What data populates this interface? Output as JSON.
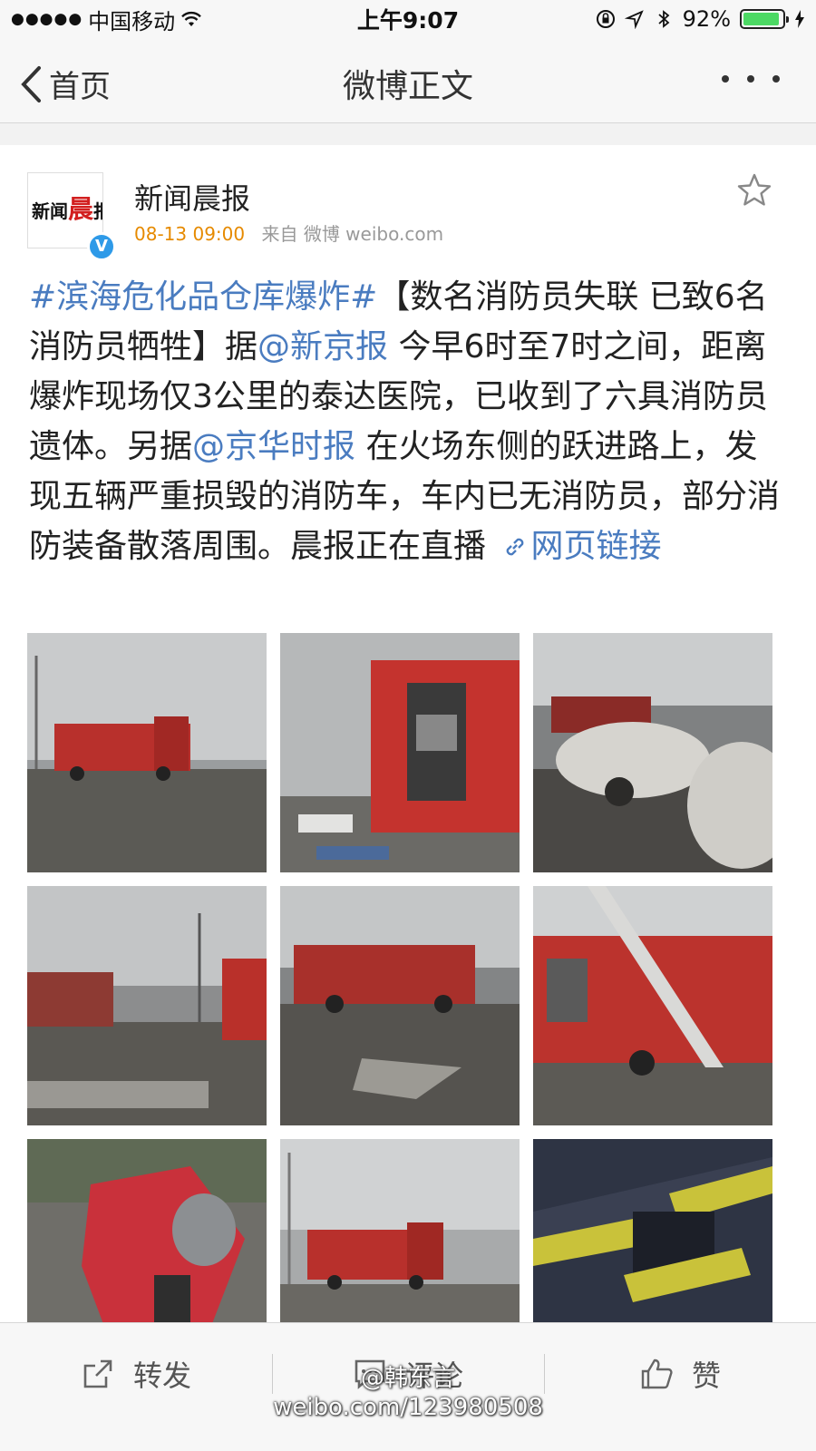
{
  "status_bar": {
    "carrier": "中国移动",
    "time": "上午9:07",
    "battery": "92%",
    "battery_level": 0.92
  },
  "nav": {
    "back_label": "首页",
    "title": "微博正文"
  },
  "post": {
    "author": "新闻晨报",
    "avatar_text_a": "新闻",
    "avatar_text_b": "晨",
    "avatar_text_c": "报",
    "time": "08-13 09:00",
    "source": "来自 微博 weibo.com",
    "body": {
      "hashtag": "#滨海危化品仓库爆炸#",
      "text1": "【数名消防员失联 已致6名消防员牺牲】据",
      "mention1": "@新京报",
      "text2": " 今早6时至7时之间，距离爆炸现场仅3公里的泰达医院，已收到了六具消防员遗体。另据",
      "mention2": "@京华时报",
      "text3": " 在火场东侧的跃进路上，发现五辆严重损毁的消防车，车内已无消防员，部分消防装备散落周围。晨报正在直播 ",
      "link_label": "网页链接"
    },
    "photos": [
      {
        "name": "fire-truck-distance-photo"
      },
      {
        "name": "fire-truck-side-photo"
      },
      {
        "name": "burned-car-photo"
      },
      {
        "name": "debris-street-photo"
      },
      {
        "name": "damaged-trucks-photo"
      },
      {
        "name": "truck-ladder-photo"
      },
      {
        "name": "red-bag-photo"
      },
      {
        "name": "truck-smoke-photo"
      },
      {
        "name": "firefighter-gear-photo"
      }
    ]
  },
  "toolbar": {
    "repost_label": "转发",
    "comment_label": "评论",
    "like_label": "赞"
  },
  "watermark": {
    "line1": "@韩东言",
    "line2": "weibo.com/123980508"
  }
}
